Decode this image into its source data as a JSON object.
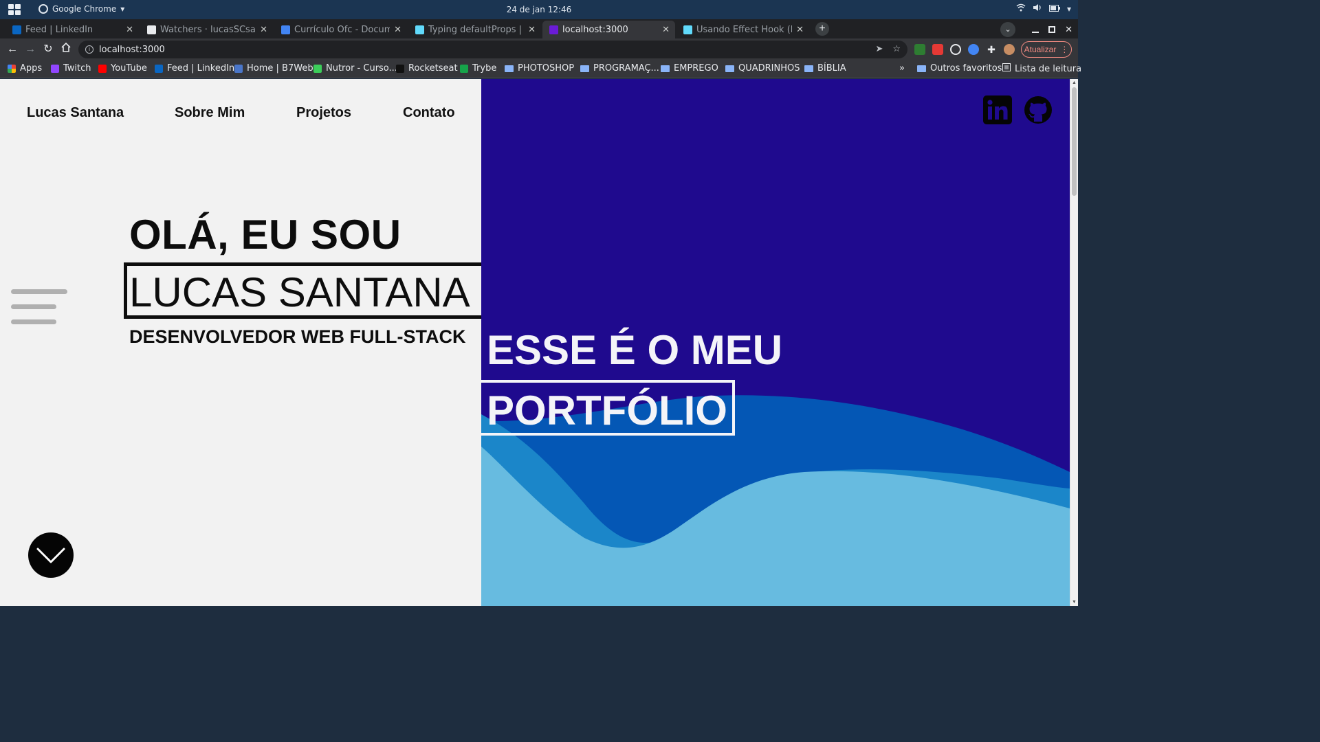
{
  "os": {
    "app_name": "Google Chrome",
    "clock": "24 de jan  12:46"
  },
  "tabs": [
    {
      "title": "Feed | LinkedIn",
      "favicon": "linkedin-icon",
      "color": "#0a66c2"
    },
    {
      "title": "Watchers · lucasSCsantos",
      "favicon": "github-icon",
      "color": "#e8eaed"
    },
    {
      "title": "Currículo Ofc - Document",
      "favicon": "docs-icon",
      "color": "#4285f4"
    },
    {
      "title": "Typing defaultProps | Rea",
      "favicon": "typescript-icon",
      "color": "#61dafb"
    },
    {
      "title": "localhost:3000",
      "favicon": "local-icon",
      "color": "#6a1bd6"
    },
    {
      "title": "Usando Effect Hook (Hook",
      "favicon": "react-icon",
      "color": "#61dafb"
    }
  ],
  "toolbar": {
    "url": "localhost:3000",
    "update_label": "Atualizar"
  },
  "bookmarks": {
    "items": [
      {
        "label": "Apps",
        "type": "apps"
      },
      {
        "label": "Twitch",
        "type": "site",
        "color": "#9146ff"
      },
      {
        "label": "YouTube",
        "type": "site",
        "color": "#ff0000"
      },
      {
        "label": "Feed | LinkedIn",
        "type": "site",
        "color": "#0a66c2"
      },
      {
        "label": "Home | B7Web",
        "type": "site",
        "color": "#4a76c9"
      },
      {
        "label": "Nutror - Curso...",
        "type": "site",
        "color": "#3ccd5a"
      },
      {
        "label": "Rocketseat",
        "type": "site",
        "color": "#111111"
      },
      {
        "label": "Trybe",
        "type": "site",
        "color": "#16a34a"
      },
      {
        "label": "PHOTOSHOP",
        "type": "folder"
      },
      {
        "label": "PROGRAMAÇ...",
        "type": "folder"
      },
      {
        "label": "EMPREGO",
        "type": "folder"
      },
      {
        "label": "QUADRINHOS",
        "type": "folder"
      },
      {
        "label": "BÍBLIA",
        "type": "folder"
      }
    ],
    "overflow": "»",
    "other_favorites": "Outros favoritos",
    "reading_list": "Lista de leitura"
  },
  "page": {
    "nav": {
      "brand": "Lucas Santana",
      "about": "Sobre Mim",
      "projects": "Projetos",
      "contact": "Contato"
    },
    "hero": {
      "greeting": "OLÁ, EU SOU",
      "name": "LUCAS SANTANA",
      "role": "DESENVOLVEDOR WEB FULL-STACK"
    },
    "portfolio": {
      "line1": "ESSE É O MEU",
      "line2": "PORTFÓLIO"
    },
    "colors": {
      "left_bg": "#f2f2f2",
      "right_bg": "#1f0a8e",
      "wave_dark": "#0457b5",
      "wave_mid": "#1b86c9",
      "wave_light": "#67bbe0"
    }
  }
}
